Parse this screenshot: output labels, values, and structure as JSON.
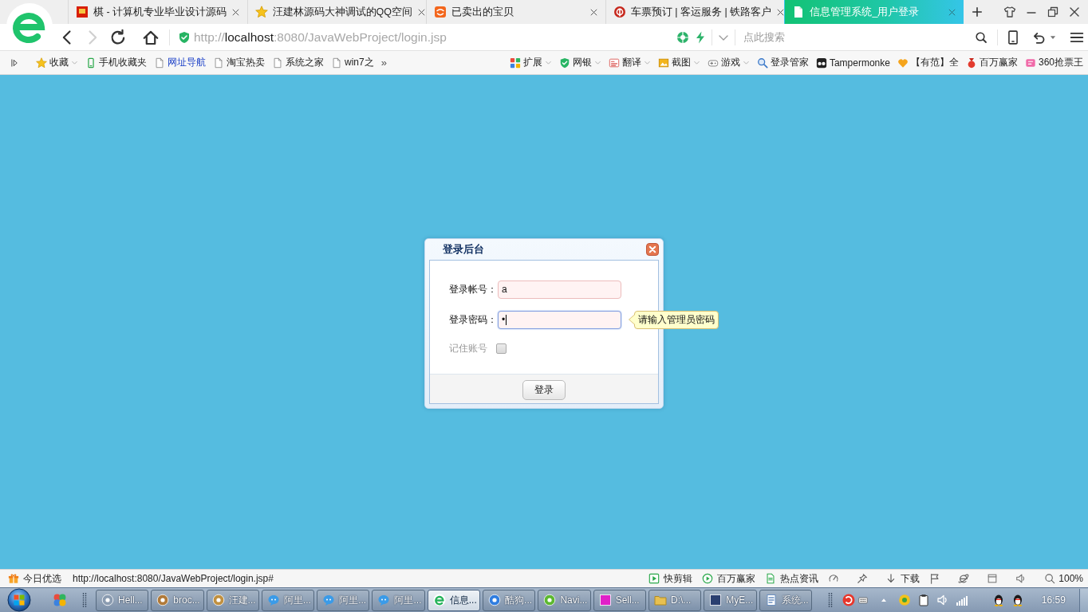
{
  "browser_tabs": [
    {
      "title": "棋 - 计算机专业毕业设计源码",
      "selected": false
    },
    {
      "title": "汪建林源码大神调试的QQ空间",
      "selected": false
    },
    {
      "title": "已卖出的宝贝",
      "selected": false
    },
    {
      "title": "车票预订 | 客运服务 | 铁路客户",
      "selected": false
    },
    {
      "title": "信息管理系统_用户登录",
      "selected": true
    }
  ],
  "address_bar": {
    "nav_buttons": [
      {
        "kind": "back",
        "disabled": false
      },
      {
        "kind": "forward",
        "disabled": true
      },
      {
        "kind": "reload",
        "disabled": false
      },
      {
        "kind": "home",
        "disabled": false
      }
    ],
    "url": {
      "scheme": "http://",
      "host": "localhost",
      "path": ":8080/JavaWebProject/login.jsp"
    },
    "search": {
      "placeholder": "点此搜索"
    }
  },
  "bookmarks_bar": {
    "left": [
      {
        "label": "收藏",
        "dropdown": true,
        "highlighted": false
      },
      {
        "label": "手机收藏夹",
        "dropdown": false,
        "highlighted": false
      },
      {
        "label": "网址导航",
        "dropdown": false,
        "highlighted": true
      },
      {
        "label": "淘宝热卖",
        "dropdown": false,
        "highlighted": false
      },
      {
        "label": "系统之家",
        "dropdown": false,
        "highlighted": false
      },
      {
        "label": "win7之",
        "dropdown": false,
        "highlighted": false
      }
    ],
    "overflow": "»",
    "right": [
      {
        "label": "扩展",
        "dropdown": true
      },
      {
        "label": "网银",
        "dropdown": true
      },
      {
        "label": "翻译",
        "dropdown": true
      },
      {
        "label": "截图",
        "dropdown": true
      },
      {
        "label": "游戏",
        "dropdown": true
      },
      {
        "label": "登录管家",
        "dropdown": false
      },
      {
        "label": "Tampermonke",
        "dropdown": false
      },
      {
        "label": "【有范】全",
        "dropdown": false
      },
      {
        "label": "百万赢家",
        "dropdown": false
      },
      {
        "label": "360抢票王",
        "dropdown": false
      }
    ]
  },
  "page": {
    "dialog": {
      "title": "登录后台",
      "fields": [
        {
          "label": "登录帐号：",
          "value": "a",
          "focused": false,
          "invalid": true
        },
        {
          "label": "登录密码：",
          "value": "•",
          "focused": true,
          "invalid": true
        }
      ],
      "tooltip": "请输入管理员密码",
      "remember": {
        "label": "记住账号",
        "checked": false,
        "disabled": true
      },
      "submit": "登录"
    }
  },
  "status_bar": {
    "promo": "今日优选",
    "link": "http://localhost:8080/JavaWebProject/login.jsp#",
    "tools": [
      "快剪辑",
      "百万赢家",
      "热点资讯"
    ],
    "download": "下载",
    "zoom": "100%"
  },
  "taskbar": {
    "buttons": [
      {
        "label": "Hell...",
        "selected": false
      },
      {
        "label": "broc...",
        "selected": false
      },
      {
        "label": "汪建...",
        "selected": false
      },
      {
        "label": "阿里...",
        "selected": false
      },
      {
        "label": "阿里...",
        "selected": false
      },
      {
        "label": "阿里...",
        "selected": false
      },
      {
        "label": "信息...",
        "selected": true
      },
      {
        "label": "酷狗...",
        "selected": false
      },
      {
        "label": "Navi...",
        "selected": false
      },
      {
        "label": "Sell...",
        "selected": false
      },
      {
        "label": "D:\\...",
        "selected": false
      },
      {
        "label": "MyE...",
        "selected": false
      },
      {
        "label": "系统...",
        "selected": false
      }
    ],
    "clock": "16:59"
  }
}
